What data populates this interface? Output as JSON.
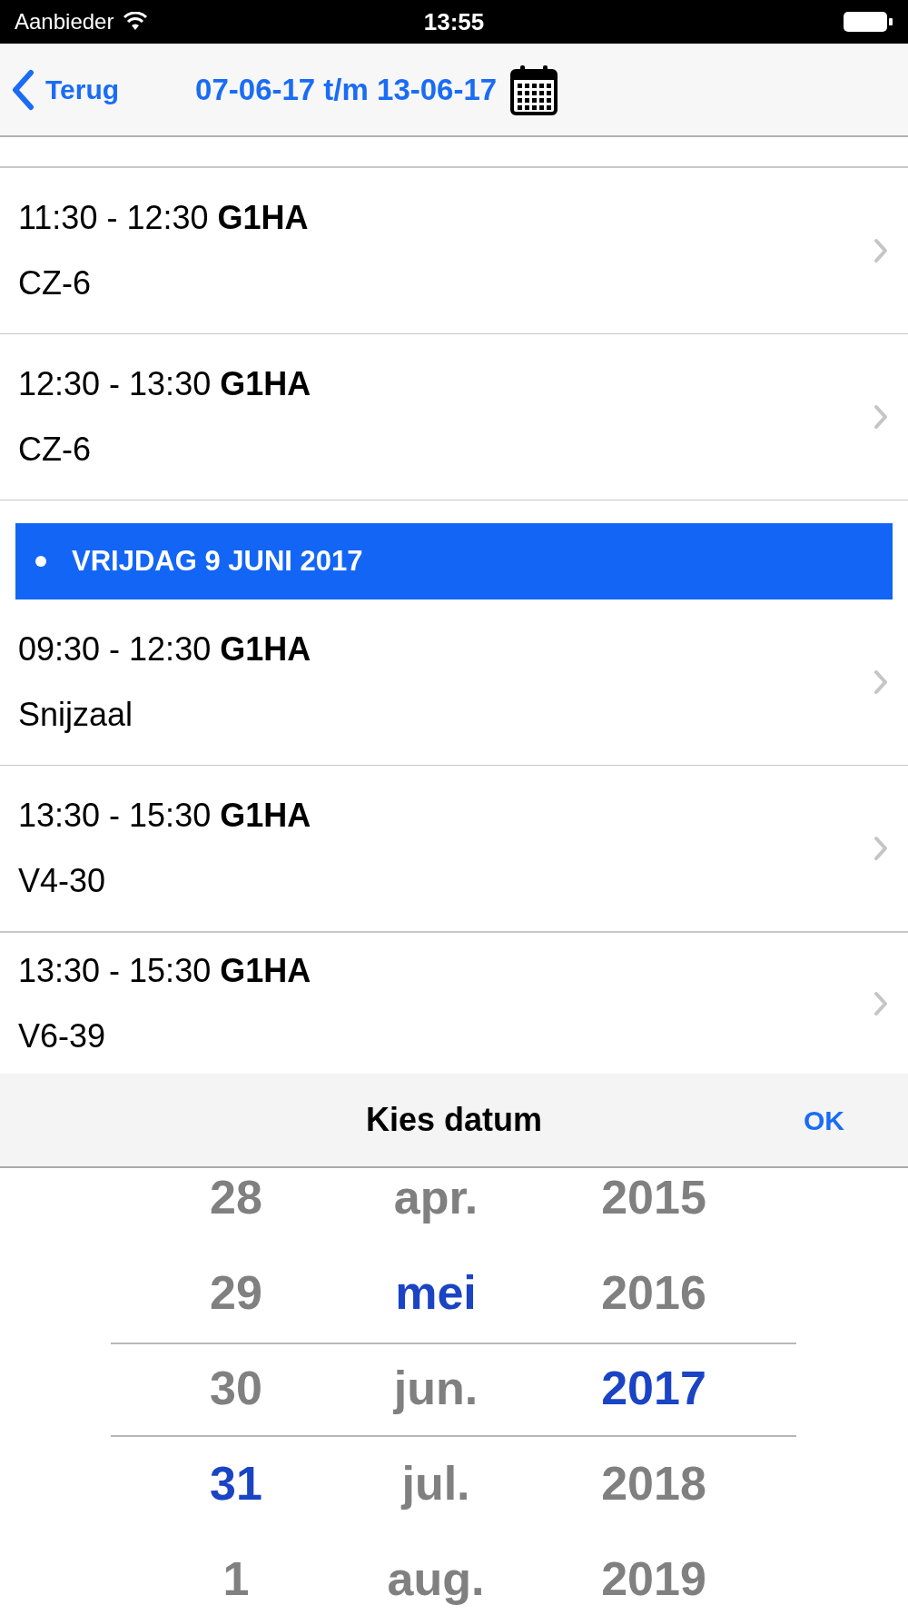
{
  "status_bar": {
    "carrier": "Aanbieder",
    "time": "13:55"
  },
  "nav": {
    "back": "Terug",
    "title": "07-06-17 t/m 13-06-17"
  },
  "list": [
    {
      "kind": "event",
      "time": "11:30 - 12:30",
      "group": "G1HA",
      "location": "CZ-6"
    },
    {
      "kind": "event",
      "time": "12:30 - 13:30",
      "group": "G1HA",
      "location": "CZ-6"
    },
    {
      "kind": "header",
      "label": "VRIJDAG 9 JUNI 2017"
    },
    {
      "kind": "event",
      "time": "09:30 - 12:30",
      "group": "G1HA",
      "location": "Snijzaal"
    },
    {
      "kind": "event",
      "time": "13:30 - 15:30",
      "group": "G1HA",
      "location": "V4-30"
    },
    {
      "kind": "event",
      "time": "13:30 - 15:30",
      "group": "G1HA",
      "location": "V6-39"
    }
  ],
  "picker": {
    "title": "Kies datum",
    "ok": "OK",
    "columns": [
      {
        "items": [
          {
            "label": "28",
            "selected": false
          },
          {
            "label": "29",
            "selected": false
          },
          {
            "label": "30",
            "selected": false
          },
          {
            "label": "31",
            "selected": true
          },
          {
            "label": "1",
            "selected": false
          }
        ]
      },
      {
        "items": [
          {
            "label": "apr.",
            "selected": false
          },
          {
            "label": "mei",
            "selected": true
          },
          {
            "label": "jun.",
            "selected": false
          },
          {
            "label": "jul.",
            "selected": false
          },
          {
            "label": "aug.",
            "selected": false
          }
        ]
      },
      {
        "items": [
          {
            "label": "2015",
            "selected": false
          },
          {
            "label": "2016",
            "selected": false
          },
          {
            "label": "2017",
            "selected": true
          },
          {
            "label": "2018",
            "selected": false
          },
          {
            "label": "2019",
            "selected": false
          }
        ]
      }
    ]
  }
}
